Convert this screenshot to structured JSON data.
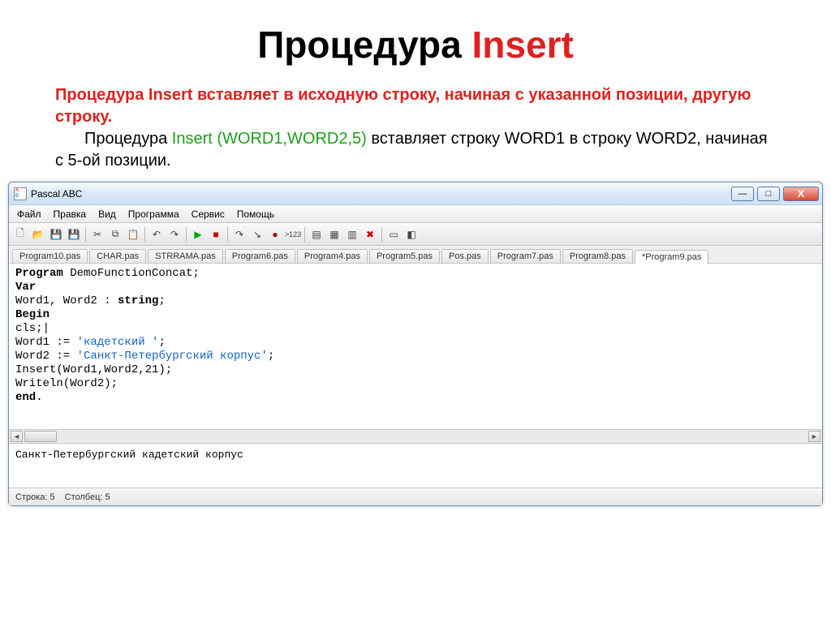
{
  "slide": {
    "title_black": "Процедура ",
    "title_red": "Insert",
    "desc_lead": "Процедура Insert вставляет в исходную строку, начиная с указанной позиции, другую строку.",
    "desc_rest1": "Процедура ",
    "desc_proc": "Insert (WORD1,WORD2,5)",
    "desc_rest2": " вставляет строку WORD1  в строку WORD2, начиная с 5-ой позиции."
  },
  "window": {
    "title": "Pascal ABC",
    "menu": [
      "Файл",
      "Правка",
      "Вид",
      "Программа",
      "Сервис",
      "Помощь"
    ],
    "tabs": [
      "Program10.pas",
      "CHAR.pas",
      "STRRAMA.pas",
      "Program6.pas",
      "Program4.pas",
      "Program5.pas",
      "Pos.pas",
      "Program7.pas",
      "Program8.pas",
      "*Program9.pas"
    ],
    "active_tab": 9,
    "code": {
      "l1a": "Program",
      "l1b": " DemoFunctionConcat;",
      "l2": "Var",
      "l3a": "Word1, Word2 : ",
      "l3b": "string",
      "l3c": ";",
      "l4": "Begin",
      "l5": "cls;|",
      "l6a": "Word1 := ",
      "l6b": "'кадетский '",
      "l6c": ";",
      "l7a": "Word2 := ",
      "l7b": "'Санкт-Петербургский корпус'",
      "l7c": ";",
      "l8": "Insert(Word1,Word2,21);",
      "l9": "Writeln(Word2);",
      "l10": "end",
      "l10b": "."
    },
    "output": "Санкт-Петербургский кадетский корпус",
    "status_line": "Строка: 5",
    "status_col": "Столбец: 5"
  }
}
